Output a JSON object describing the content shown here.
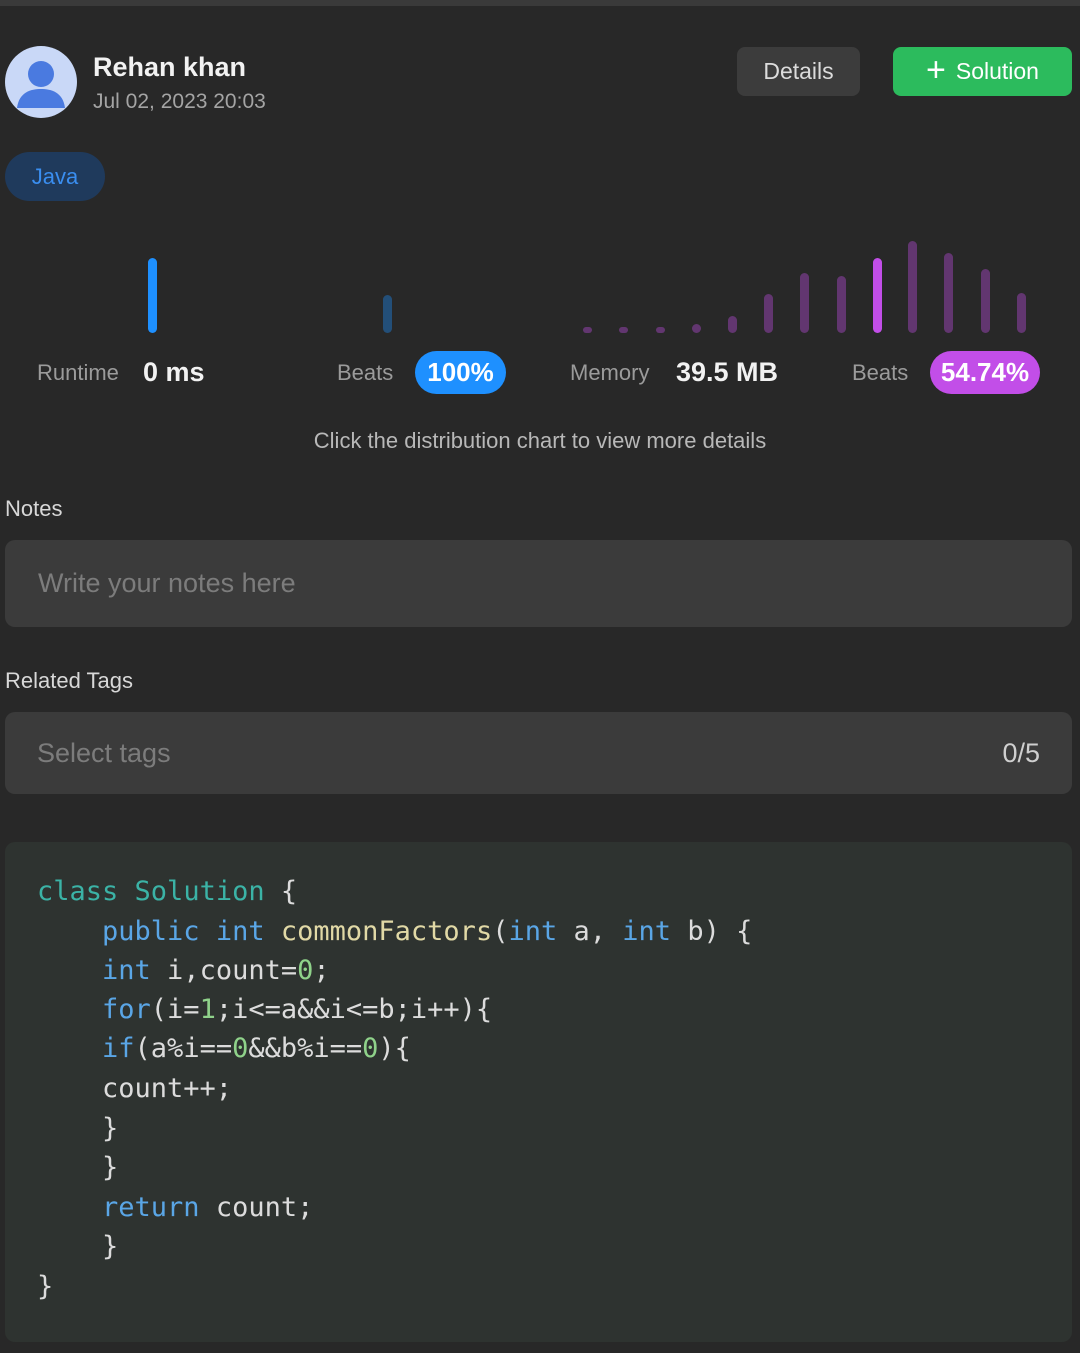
{
  "user": {
    "name": "Rehan khan",
    "date": "Jul 02, 2023 20:03"
  },
  "actions": {
    "details_label": "Details",
    "solution_label": "Solution"
  },
  "language_chip": "Java",
  "runtime": {
    "label": "Runtime",
    "value": "0 ms",
    "beats_label": "Beats",
    "beats_value": "100%",
    "accent": "#1e90ff"
  },
  "memory": {
    "label": "Memory",
    "value": "39.5 MB",
    "beats_label": "Beats",
    "beats_value": "54.74%",
    "accent": "#c24ee8"
  },
  "chart_data": [
    {
      "type": "bar",
      "series": [
        {
          "values": [
            1.0,
            0.5
          ]
        }
      ],
      "highlight_index": 0,
      "color": "#1e90ff"
    },
    {
      "type": "bar",
      "series": [
        {
          "values": [
            0.06,
            0.06,
            0.06,
            0.1,
            0.18,
            0.42,
            0.65,
            0.62,
            0.82,
            1.0,
            0.87,
            0.7,
            0.43
          ]
        }
      ],
      "highlight_index": 8,
      "color": "#c24ee8"
    }
  ],
  "hint": "Click the distribution chart to view more details",
  "notes": {
    "label": "Notes",
    "placeholder": "Write your notes here"
  },
  "tags": {
    "label": "Related Tags",
    "placeholder": "Select tags",
    "count": "0/5"
  },
  "code_lines": [
    [
      {
        "t": "class",
        "c": "type"
      },
      {
        "t": " ",
        "c": "txt"
      },
      {
        "t": "Solution",
        "c": "type"
      },
      {
        "t": " {",
        "c": "txt"
      }
    ],
    [
      {
        "t": "    public",
        "c": "kw"
      },
      {
        "t": " ",
        "c": "txt"
      },
      {
        "t": "int",
        "c": "kw"
      },
      {
        "t": " ",
        "c": "txt"
      },
      {
        "t": "commonFactors",
        "c": "fn"
      },
      {
        "t": "(",
        "c": "txt"
      },
      {
        "t": "int",
        "c": "kw"
      },
      {
        "t": " a, ",
        "c": "txt"
      },
      {
        "t": "int",
        "c": "kw"
      },
      {
        "t": " b) {",
        "c": "txt"
      }
    ],
    [
      {
        "t": "    int",
        "c": "kw"
      },
      {
        "t": " i,count=",
        "c": "txt"
      },
      {
        "t": "0",
        "c": "num"
      },
      {
        "t": ";",
        "c": "txt"
      }
    ],
    [
      {
        "t": "    for",
        "c": "kw"
      },
      {
        "t": "(i=",
        "c": "txt"
      },
      {
        "t": "1",
        "c": "num"
      },
      {
        "t": ";i<=a&&i<=b;i++){",
        "c": "txt"
      }
    ],
    [
      {
        "t": "    if",
        "c": "kw"
      },
      {
        "t": "(a%i==",
        "c": "txt"
      },
      {
        "t": "0",
        "c": "num"
      },
      {
        "t": "&&b%i==",
        "c": "txt"
      },
      {
        "t": "0",
        "c": "num"
      },
      {
        "t": "){",
        "c": "txt"
      }
    ],
    [
      {
        "t": "    count++;",
        "c": "txt"
      }
    ],
    [
      {
        "t": "    }",
        "c": "txt"
      }
    ],
    [
      {
        "t": "    }",
        "c": "txt"
      }
    ],
    [
      {
        "t": "    return",
        "c": "kw"
      },
      {
        "t": " count;",
        "c": "txt"
      }
    ],
    [
      {
        "t": "    }",
        "c": "txt"
      }
    ],
    [
      {
        "t": "}",
        "c": "txt"
      }
    ]
  ]
}
